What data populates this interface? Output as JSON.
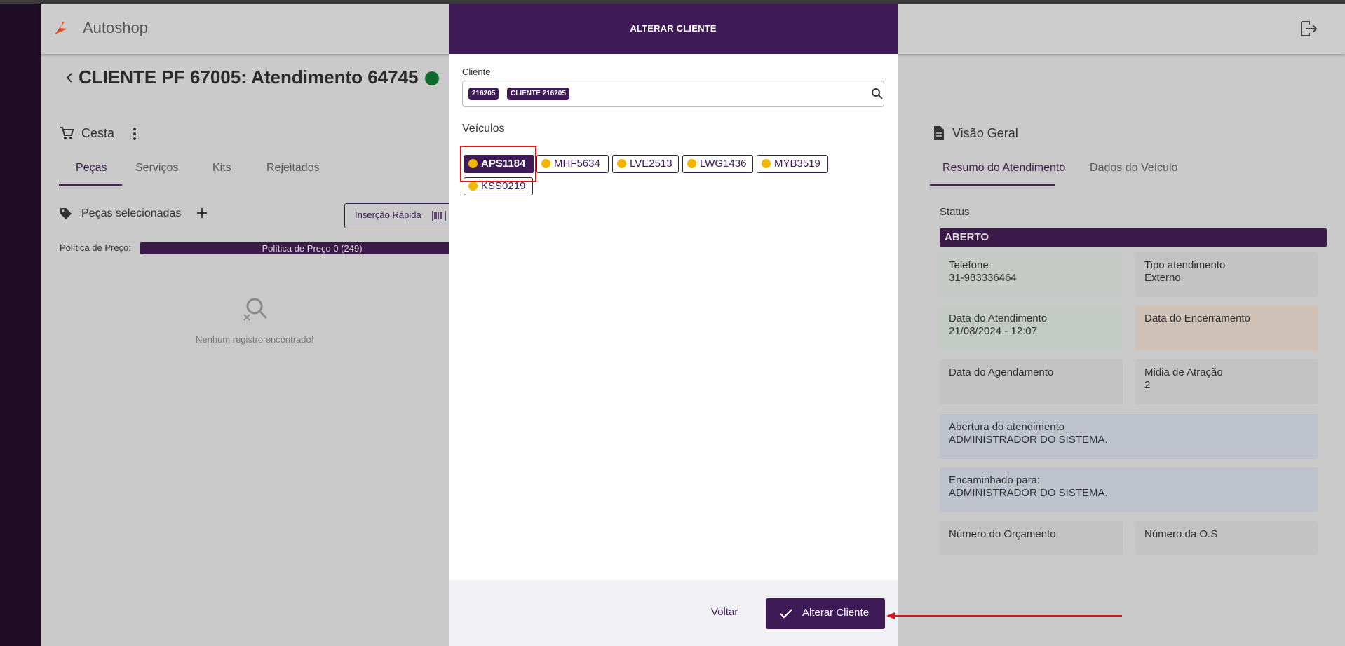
{
  "app": {
    "name": "Autoshop"
  },
  "page": {
    "title": "CLIENTE PF 67005: Atendimento 64745"
  },
  "left_panel": {
    "section_title": "Cesta",
    "tabs": [
      "Peças",
      "Serviços",
      "Kits",
      "Rejeitados"
    ],
    "active_tab": "Peças",
    "selected_parts_label": "Peças selecionadas",
    "quick_insert_label": "Inserção Rápida",
    "price_policy_label": "Política de Preço:",
    "price_policy_value": "Política de Preço 0 (249)",
    "empty_message": "Nenhum registro encontrado!"
  },
  "right_panel": {
    "section_title": "Visão Geral",
    "tabs": [
      "Resumo do Atendimento",
      "Dados do Veículo"
    ],
    "active_tab": "Resumo do Atendimento",
    "status_label": "Status",
    "status_value": "ABERTO",
    "cards": {
      "telefone": {
        "label": "Telefone",
        "value": "31-983336464"
      },
      "tipo": {
        "label": "Tipo atendimento",
        "value": "Externo"
      },
      "data_atendimento": {
        "label": "Data do Atendimento",
        "value": "21/08/2024 - 12:07"
      },
      "data_encerramento": {
        "label": "Data do Encerramento",
        "value": ""
      },
      "data_agendamento": {
        "label": "Data do Agendamento",
        "value": ""
      },
      "midia": {
        "label": "Midia de Atração",
        "value": "2"
      },
      "abertura": {
        "label": "Abertura do atendimento",
        "value": "ADMINISTRADOR DO SISTEMA."
      },
      "encaminhado": {
        "label": "Encaminhado para:",
        "value": "ADMINISTRADOR DO SISTEMA."
      },
      "orcamento": {
        "label": "Número do Orçamento",
        "value": ""
      },
      "os": {
        "label": "Número da O.S",
        "value": ""
      }
    }
  },
  "modal": {
    "title": "ALTERAR CLIENTE",
    "client_label": "Cliente",
    "client_chips": [
      "216205",
      "CLIENTE 216205"
    ],
    "vehicles_label": "Veículos",
    "vehicles": [
      "APS1184",
      "MHF5634",
      "LVE2513",
      "LWG1436",
      "MYB3519",
      "KSS0219"
    ],
    "selected_vehicle": "APS1184",
    "back_label": "Voltar",
    "confirm_label": "Alterar Cliente"
  },
  "colors": {
    "brand": "#3e1a56",
    "status_green": "#0f6b2e",
    "vehicle_dot": "#f2b600",
    "annotation_red": "#e0141b"
  }
}
